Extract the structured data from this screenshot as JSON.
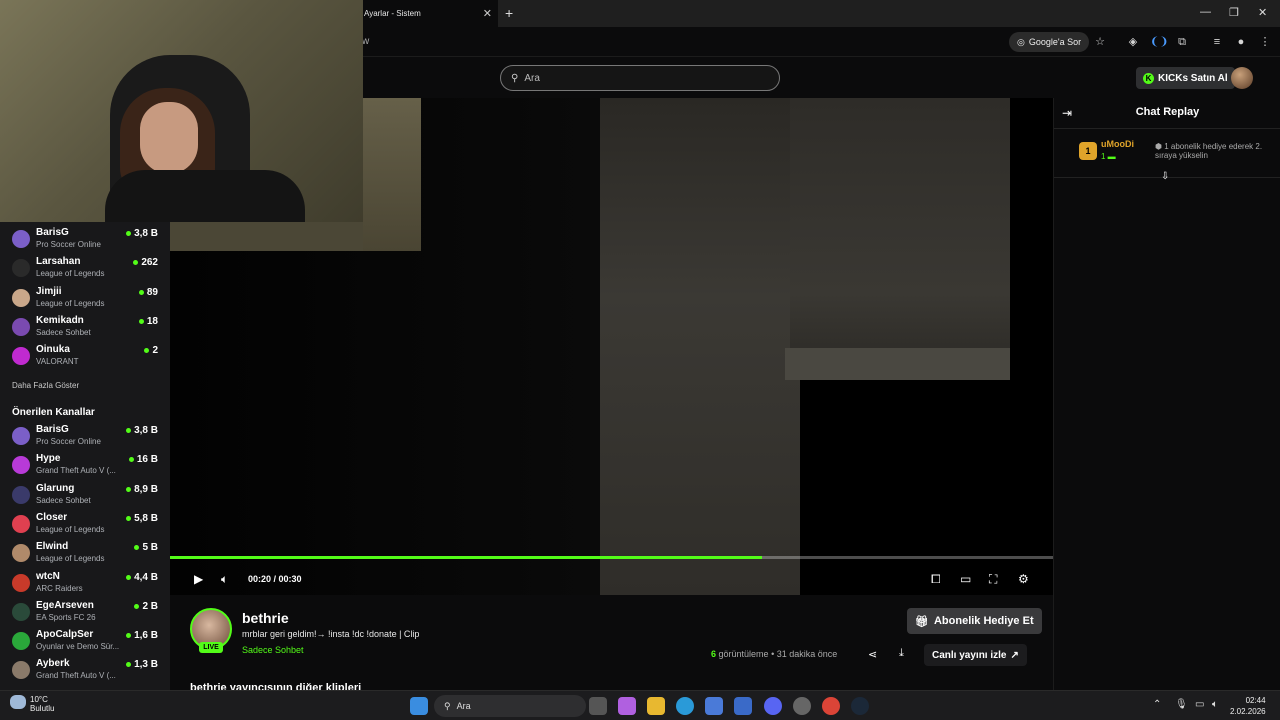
{
  "browser": {
    "tab_title": "Ayarlar - Sistem",
    "url_fragment": "w",
    "ask_google": "Google'a Sor"
  },
  "header": {
    "search_placeholder": "Ara",
    "kicks_button": "KICKs Satın Al"
  },
  "sidebar": {
    "followed": [
      {
        "name": "BarisG",
        "game": "Pro Soccer Online",
        "count": "3,8 B",
        "color": "#7b5fc8"
      },
      {
        "name": "Larsahan",
        "game": "League of Legends",
        "count": "262",
        "color": "#2a2a2a"
      },
      {
        "name": "Jimjii",
        "game": "League of Legends",
        "count": "89",
        "color": "#c9a78a"
      },
      {
        "name": "Kemikadn",
        "game": "Sadece Sohbet",
        "count": "18",
        "color": "#7a4ab0"
      },
      {
        "name": "Oinuka",
        "game": "VALORANT",
        "count": "2",
        "color": "#c02ad0"
      }
    ],
    "show_more": "Daha Fazla Göster",
    "recommended_title": "Önerilen Kanallar",
    "recommended": [
      {
        "name": "BarisG",
        "game": "Pro Soccer Online",
        "count": "3,8 B",
        "color": "#7b5fc8"
      },
      {
        "name": "Hype",
        "game": "Grand Theft Auto V (...",
        "count": "16 B",
        "color": "#b83ad8"
      },
      {
        "name": "Glarung",
        "game": "Sadece Sohbet",
        "count": "8,9 B",
        "color": "#3a3a6a"
      },
      {
        "name": "Closer",
        "game": "League of Legends",
        "count": "5,8 B",
        "color": "#e04050"
      },
      {
        "name": "Elwind",
        "game": "League of Legends",
        "count": "5 B",
        "color": "#b08a6a"
      },
      {
        "name": "wtcN",
        "game": "ARC Raiders",
        "count": "4,4 B",
        "color": "#c83a2a"
      },
      {
        "name": "EgeArseven",
        "game": "EA Sports FC 26",
        "count": "2 B",
        "color": "#2a4a3a"
      },
      {
        "name": "ApoCalpSer",
        "game": "Oyunlar ve Demo Sür...",
        "count": "1,6 B",
        "color": "#2aa83a"
      },
      {
        "name": "Ayberk",
        "game": "Grand Theft Auto V (...",
        "count": "1,3 B",
        "color": "#8a7a6a"
      }
    ]
  },
  "player": {
    "current_time": "00:20",
    "duration": "00:30",
    "progress": 0.67
  },
  "chat": {
    "title": "Chat Replay",
    "gifter_rank": "1",
    "gifter_name": "uMooDi",
    "gifter_count": "1",
    "gift_message": "1 abonelik hediye ederek 2. sıraya yükselin"
  },
  "stream": {
    "streamer": "bethrie",
    "live_label": "LIVE",
    "clip_title": "mrblar geri geldim!→ !insta !dc !donate | Clip",
    "category": "Sadece Sohbet",
    "gift_sub_button": "Abonelik Hediye Et",
    "views_count": "6",
    "views_label": "görüntüleme",
    "posted": "• 31 dakika önce",
    "watch_live": "Canlı yayını izle",
    "other_clips": "bethrie yayıncısının diğer klipleri"
  },
  "taskbar": {
    "temperature": "10°C",
    "weather": "Bulutlu",
    "search_label": "Ara",
    "time": "02:44",
    "date": "2.02.2026"
  }
}
